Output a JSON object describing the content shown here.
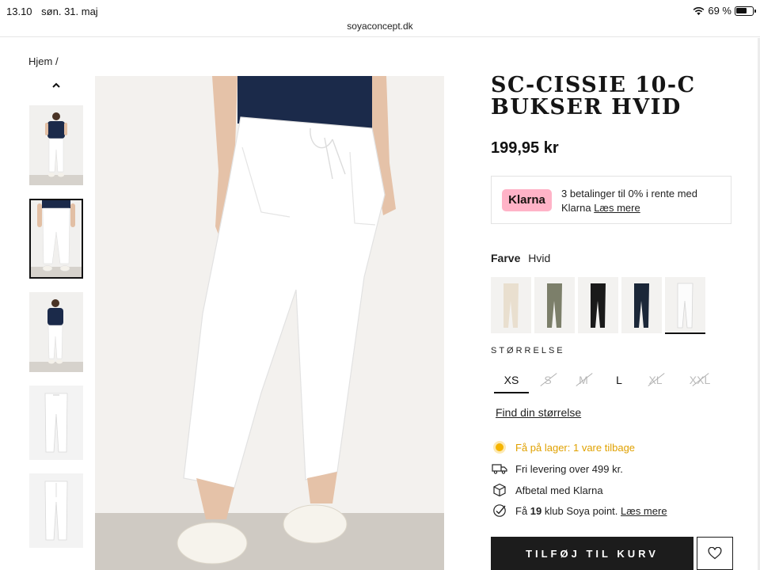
{
  "status_bar": {
    "time": "13.10",
    "date": "søn. 31. maj",
    "battery": "69 %"
  },
  "url": "soyaconcept.dk",
  "breadcrumb": "Hjem /",
  "product": {
    "title": "SC-CISSIE 10-C BUKSER HVID",
    "price": "199,95 kr"
  },
  "klarna": {
    "badge": "Klarna",
    "text": "3 betalinger til 0% i rente med Klarna",
    "link": "Læs mere"
  },
  "color": {
    "label": "Farve",
    "value": "Hvid"
  },
  "swatches": [
    {
      "name": "beige",
      "color": "#e9dfcf"
    },
    {
      "name": "olive",
      "color": "#7c7f6a"
    },
    {
      "name": "black",
      "color": "#1a1a1a"
    },
    {
      "name": "navy",
      "color": "#1b2738"
    },
    {
      "name": "white",
      "color": "#fafafa"
    }
  ],
  "sizes": {
    "label": "STØRRELSE",
    "options": [
      {
        "label": "XS",
        "available": true,
        "selected": true
      },
      {
        "label": "S",
        "available": false
      },
      {
        "label": "M",
        "available": false
      },
      {
        "label": "L",
        "available": true
      },
      {
        "label": "XL",
        "available": false
      },
      {
        "label": "XXL",
        "available": false
      }
    ]
  },
  "find_size": "Find din størrelse",
  "info": {
    "stock": "Få på lager: 1 vare tilbage",
    "delivery": "Fri levering over 499 kr.",
    "klarna_pay": "Afbetal med Klarna",
    "points_pre": "Få",
    "points_num": "19",
    "points_post": "klub Soya point.",
    "points_link": "Læs mere"
  },
  "add_to_cart": "TILFØJ TIL KURV",
  "colors": {
    "accent": "#1c1c1c",
    "klarna_pink": "#ffb3c7",
    "stock_yellow": "#f5b400"
  }
}
